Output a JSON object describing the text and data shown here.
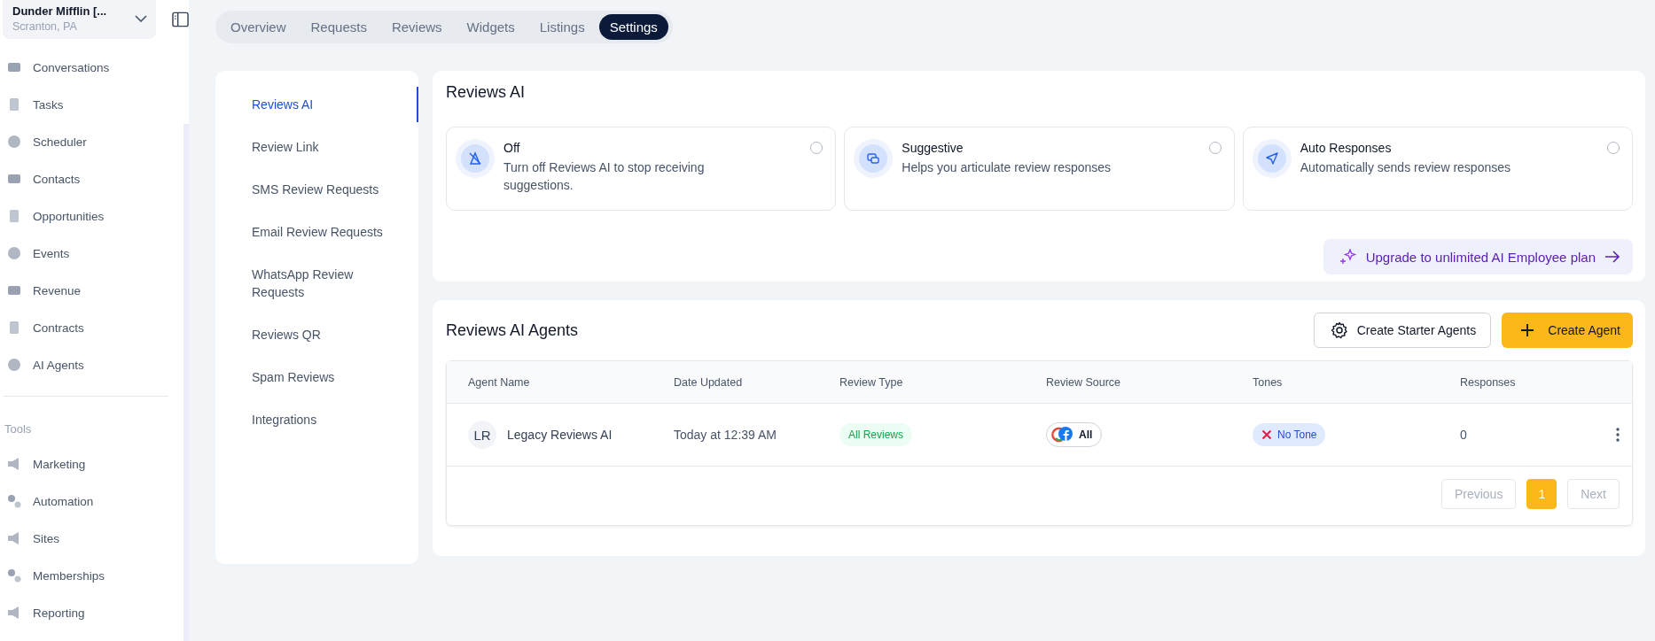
{
  "account": {
    "name": "Dunder Mifflin [...",
    "location": "Scranton, PA"
  },
  "sidebar": {
    "items": [
      {
        "label": "Conversations"
      },
      {
        "label": "Tasks"
      },
      {
        "label": "Scheduler"
      },
      {
        "label": "Contacts"
      },
      {
        "label": "Opportunities"
      },
      {
        "label": "Events"
      },
      {
        "label": "Revenue"
      },
      {
        "label": "Contracts"
      },
      {
        "label": "AI Agents"
      }
    ],
    "section_title": "Tools",
    "tools": [
      {
        "label": "Marketing"
      },
      {
        "label": "Automation"
      },
      {
        "label": "Sites"
      },
      {
        "label": "Memberships"
      },
      {
        "label": "Reporting"
      }
    ]
  },
  "tabs": [
    {
      "label": "Overview",
      "selected": false
    },
    {
      "label": "Requests",
      "selected": false
    },
    {
      "label": "Reviews",
      "selected": false
    },
    {
      "label": "Widgets",
      "selected": false
    },
    {
      "label": "Listings",
      "selected": false
    },
    {
      "label": "Settings",
      "selected": true
    }
  ],
  "settings_nav": [
    {
      "label": "Reviews AI",
      "selected": true
    },
    {
      "label": "Review Link",
      "selected": false
    },
    {
      "label": "SMS Review Requests",
      "selected": false
    },
    {
      "label": "Email Review Requests",
      "selected": false
    },
    {
      "label": "WhatsApp Review Requests",
      "selected": false
    },
    {
      "label": "Reviews QR",
      "selected": false
    },
    {
      "label": "Spam Reviews",
      "selected": false
    },
    {
      "label": "Integrations",
      "selected": false
    }
  ],
  "reviews_ai": {
    "title": "Reviews AI",
    "options": [
      {
        "title": "Off",
        "description": "Turn off Reviews AI to stop receiving suggestions.",
        "selected": false
      },
      {
        "title": "Suggestive",
        "description": "Helps you articulate review responses",
        "selected": false
      },
      {
        "title": "Auto Responses",
        "description": "Automatically sends review responses",
        "selected": false
      }
    ],
    "upgrade_button": "Upgrade to unlimited AI Employee plan"
  },
  "agents": {
    "title": "Reviews AI Agents",
    "starter_button": "Create Starter Agents",
    "create_button": "Create Agent",
    "columns": [
      "Agent Name",
      "Date Updated",
      "Review Type",
      "Review Source",
      "Tones",
      "Responses"
    ],
    "rows": [
      {
        "initials": "LR",
        "name": "Legacy Reviews AI",
        "date": "Today at 12:39 AM",
        "review_type": "All Reviews",
        "source": "All",
        "tone": "No Tone",
        "responses": "0"
      }
    ],
    "pagination": [
      {
        "label": "Previous",
        "kind": "nav",
        "disabled": true,
        "selected": false
      },
      {
        "label": "1",
        "kind": "page",
        "disabled": false,
        "selected": true
      },
      {
        "label": "Next",
        "kind": "nav",
        "disabled": true,
        "selected": false
      }
    ]
  }
}
